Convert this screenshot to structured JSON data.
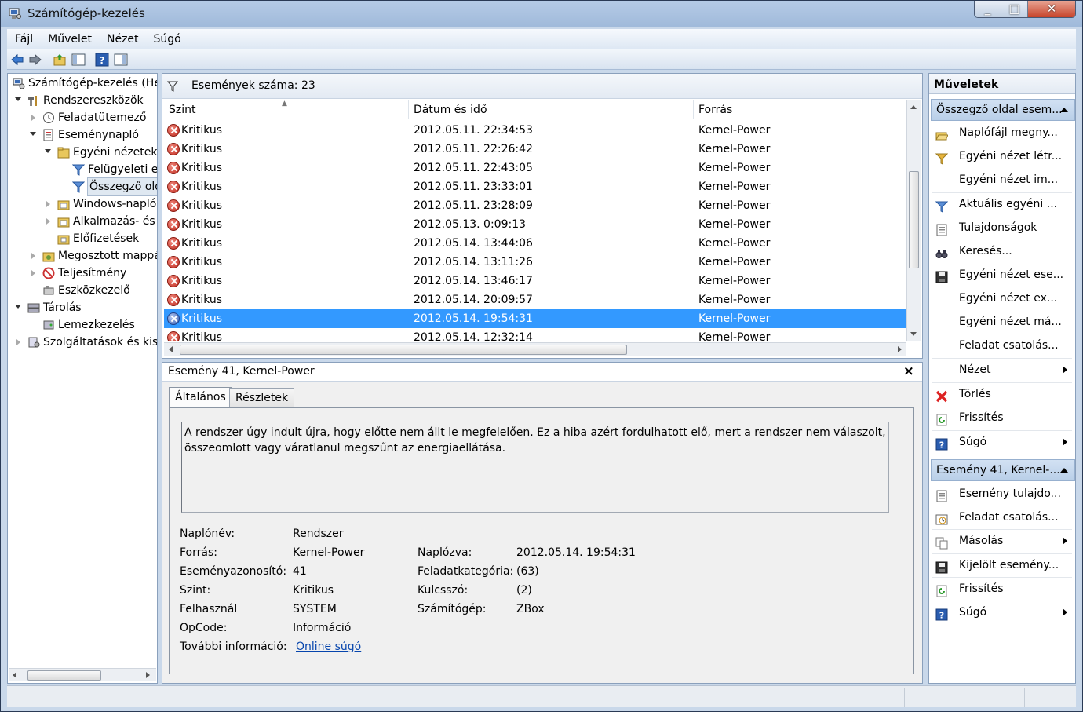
{
  "window": {
    "title": "Számítógép-kezelés"
  },
  "menu": [
    "Fájl",
    "Művelet",
    "Nézet",
    "Súgó"
  ],
  "tree": {
    "items": [
      {
        "label": "Számítógép-kezelés (He",
        "indent": 0,
        "arrow": "none"
      },
      {
        "label": "Rendszereszközök",
        "indent": 1,
        "arrow": "down"
      },
      {
        "label": "Feladatütemező",
        "indent": 2,
        "arrow": "right"
      },
      {
        "label": "Eseménynapló",
        "indent": 2,
        "arrow": "down"
      },
      {
        "label": "Egyéni nézetek",
        "indent": 3,
        "arrow": "down"
      },
      {
        "label": "Felügyeleti es",
        "indent": 4,
        "arrow": "none"
      },
      {
        "label": "Összegző old",
        "indent": 4,
        "arrow": "none",
        "selected": true
      },
      {
        "label": "Windows-napló",
        "indent": 3,
        "arrow": "right"
      },
      {
        "label": "Alkalmazás- és s",
        "indent": 3,
        "arrow": "right"
      },
      {
        "label": "Előfizetések",
        "indent": 3,
        "arrow": "none"
      },
      {
        "label": "Megosztott mappá",
        "indent": 2,
        "arrow": "right"
      },
      {
        "label": "Teljesítmény",
        "indent": 2,
        "arrow": "right"
      },
      {
        "label": "Eszközkezelő",
        "indent": 2,
        "arrow": "none"
      },
      {
        "label": "Tárolás",
        "indent": 1,
        "arrow": "down"
      },
      {
        "label": "Lemezkezelés",
        "indent": 2,
        "arrow": "none"
      },
      {
        "label": "Szolgáltatások és kisz",
        "indent": 1,
        "arrow": "right"
      }
    ]
  },
  "events": {
    "header": "Események száma: 23",
    "columns": [
      "Szint",
      "Dátum és idő",
      "Forrás"
    ],
    "rows": [
      {
        "level": "Kritikus",
        "datetime": "2012.05.11. 22:34:53",
        "source": "Kernel-Power"
      },
      {
        "level": "Kritikus",
        "datetime": "2012.05.11. 22:26:42",
        "source": "Kernel-Power"
      },
      {
        "level": "Kritikus",
        "datetime": "2012.05.11. 22:43:05",
        "source": "Kernel-Power"
      },
      {
        "level": "Kritikus",
        "datetime": "2012.05.11. 23:33:01",
        "source": "Kernel-Power"
      },
      {
        "level": "Kritikus",
        "datetime": "2012.05.11. 23:28:09",
        "source": "Kernel-Power"
      },
      {
        "level": "Kritikus",
        "datetime": "2012.05.13. 0:09:13",
        "source": "Kernel-Power"
      },
      {
        "level": "Kritikus",
        "datetime": "2012.05.14. 13:44:06",
        "source": "Kernel-Power"
      },
      {
        "level": "Kritikus",
        "datetime": "2012.05.14. 13:11:26",
        "source": "Kernel-Power"
      },
      {
        "level": "Kritikus",
        "datetime": "2012.05.14. 13:46:17",
        "source": "Kernel-Power"
      },
      {
        "level": "Kritikus",
        "datetime": "2012.05.14. 20:09:57",
        "source": "Kernel-Power"
      },
      {
        "level": "Kritikus",
        "datetime": "2012.05.14. 19:54:31",
        "source": "Kernel-Power",
        "selected": true
      },
      {
        "level": "Kritikus",
        "datetime": "2012.05.14. 12:32:14",
        "source": "Kernel-Power"
      }
    ]
  },
  "detail": {
    "title": "Esemény 41, Kernel-Power",
    "tabs": [
      "Általános",
      "Részletek"
    ],
    "message": "A rendszer úgy indult újra, hogy előtte nem állt le megfelelően. Ez a hiba azért fordulhatott elő, mert a rendszer nem válaszolt, összeomlott vagy váratlanul megszűnt az energiaellátása.",
    "fields_left": [
      {
        "label": "Naplónév:",
        "value": "Rendszer"
      },
      {
        "label": "Forrás:",
        "value": "Kernel-Power"
      },
      {
        "label": "Eseményazonosító:",
        "value": "41"
      },
      {
        "label": "Szint:",
        "value": "Kritikus"
      },
      {
        "label": "Felhasznál",
        "value": "SYSTEM"
      },
      {
        "label": "OpCode:",
        "value": "Információ"
      },
      {
        "label": "További információ:",
        "value": "Online súgó"
      }
    ],
    "fields_right": [
      {
        "label": "Naplózva:",
        "value": "2012.05.14. 19:54:31"
      },
      {
        "label": "Feladatkategória:",
        "value": "(63)"
      },
      {
        "label": "Kulcsszó:",
        "value": "(2)"
      },
      {
        "label": "Számítógép:",
        "value": "ZBox"
      }
    ]
  },
  "actions": {
    "title": "Műveletek",
    "section1": "Összegző oldal esem...",
    "items1": [
      {
        "label": "Naplófájl megny...",
        "icon": "folder-open-icon"
      },
      {
        "label": "Egyéni nézet létr...",
        "icon": "filter-create-icon"
      },
      {
        "label": "Egyéni nézet im...",
        "icon": "none"
      },
      {
        "label": "Aktuális egyéni ...",
        "icon": "filter-icon"
      },
      {
        "label": "Tulajdonságok",
        "icon": "properties-icon"
      },
      {
        "label": "Keresés...",
        "icon": "binoculars-icon"
      },
      {
        "label": "Egyéni nézet ese...",
        "icon": "save-icon"
      },
      {
        "label": "Egyéni nézet ex...",
        "icon": "none"
      },
      {
        "label": "Egyéni nézet má...",
        "icon": "none"
      },
      {
        "label": "Feladat csatolás...",
        "icon": "none"
      },
      {
        "label": "Nézet",
        "icon": "none",
        "submenu": true
      },
      {
        "label": "Törlés",
        "icon": "delete-icon"
      },
      {
        "label": "Frissítés",
        "icon": "refresh-icon"
      },
      {
        "label": "Súgó",
        "icon": "help-icon",
        "submenu": true
      }
    ],
    "section2": "Esemény 41, Kernel-...",
    "items2": [
      {
        "label": "Esemény tulajdo...",
        "icon": "properties-icon"
      },
      {
        "label": "Feladat csatolás...",
        "icon": "task-icon"
      },
      {
        "label": "Másolás",
        "icon": "copy-icon",
        "submenu": true
      },
      {
        "label": "Kijelölt esemény...",
        "icon": "save-icon"
      },
      {
        "label": "Frissítés",
        "icon": "refresh-icon"
      },
      {
        "label": "Súgó",
        "icon": "help-icon",
        "submenu": true
      }
    ]
  },
  "colors": {
    "selection": "#3399ff",
    "critical": "#c0281c",
    "link": "#0645ad"
  }
}
